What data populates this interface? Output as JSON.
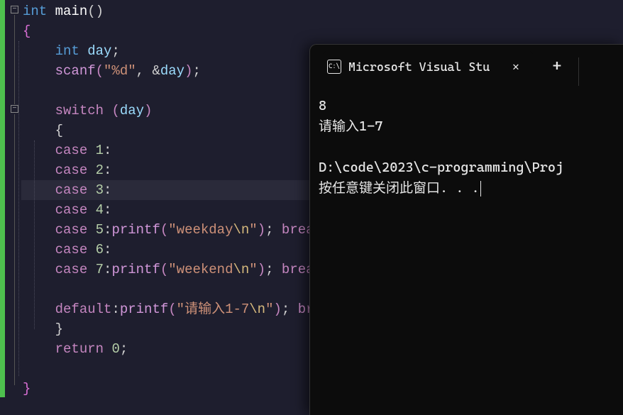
{
  "editor": {
    "fold_symbol": "−",
    "lines": [
      {
        "indent": 0,
        "tokens": [
          [
            "type",
            "int "
          ],
          [
            "white",
            "main"
          ],
          [
            "punc",
            "()"
          ]
        ]
      },
      {
        "indent": 0,
        "tokens": [
          [
            "brace",
            "{"
          ]
        ]
      },
      {
        "indent": 1,
        "tokens": [
          [
            "type",
            "int "
          ],
          [
            "var",
            "day"
          ],
          [
            "punc",
            ";"
          ]
        ]
      },
      {
        "indent": 1,
        "tokens": [
          [
            "iofunc",
            "scanf"
          ],
          [
            "paren",
            "("
          ],
          [
            "str",
            "\"%d\""
          ],
          [
            "punc",
            ", &"
          ],
          [
            "var",
            "day"
          ],
          [
            "paren",
            ")"
          ],
          [
            "punc",
            ";"
          ]
        ]
      },
      {
        "indent": 1,
        "tokens": []
      },
      {
        "indent": 1,
        "tokens": [
          [
            "ctrl",
            "switch "
          ],
          [
            "paren",
            "("
          ],
          [
            "var",
            "day"
          ],
          [
            "paren",
            ")"
          ]
        ]
      },
      {
        "indent": 1,
        "tokens": [
          [
            "punc",
            "{"
          ]
        ]
      },
      {
        "indent": 1,
        "tokens": [
          [
            "case",
            "case "
          ],
          [
            "num",
            "1"
          ],
          [
            "punc",
            ":"
          ]
        ]
      },
      {
        "indent": 1,
        "tokens": [
          [
            "case",
            "case "
          ],
          [
            "num",
            "2"
          ],
          [
            "punc",
            ":"
          ]
        ]
      },
      {
        "indent": 1,
        "hl": true,
        "tokens": [
          [
            "case",
            "case "
          ],
          [
            "num",
            "3"
          ],
          [
            "punc",
            ":"
          ]
        ]
      },
      {
        "indent": 1,
        "tokens": [
          [
            "case",
            "case "
          ],
          [
            "num",
            "4"
          ],
          [
            "punc",
            ":"
          ]
        ]
      },
      {
        "indent": 1,
        "tokens": [
          [
            "case",
            "case "
          ],
          [
            "num",
            "5"
          ],
          [
            "punc",
            ":"
          ],
          [
            "iofunc",
            "printf"
          ],
          [
            "paren",
            "("
          ],
          [
            "str",
            "\"weekday"
          ],
          [
            "esc",
            "\\n"
          ],
          [
            "str",
            "\""
          ],
          [
            "paren",
            ")"
          ],
          [
            "punc",
            "; "
          ],
          [
            "ctrl",
            "break"
          ],
          [
            "punc",
            ";"
          ]
        ]
      },
      {
        "indent": 1,
        "tokens": [
          [
            "case",
            "case "
          ],
          [
            "num",
            "6"
          ],
          [
            "punc",
            ":"
          ]
        ]
      },
      {
        "indent": 1,
        "tokens": [
          [
            "case",
            "case "
          ],
          [
            "num",
            "7"
          ],
          [
            "punc",
            ":"
          ],
          [
            "iofunc",
            "printf"
          ],
          [
            "paren",
            "("
          ],
          [
            "str",
            "\"weekend"
          ],
          [
            "esc",
            "\\n"
          ],
          [
            "str",
            "\""
          ],
          [
            "paren",
            ")"
          ],
          [
            "punc",
            "; "
          ],
          [
            "ctrl",
            "break"
          ],
          [
            "punc",
            ";"
          ]
        ]
      },
      {
        "indent": 1,
        "tokens": []
      },
      {
        "indent": 1,
        "tokens": [
          [
            "case",
            "default"
          ],
          [
            "punc",
            ":"
          ],
          [
            "iofunc",
            "printf"
          ],
          [
            "paren",
            "("
          ],
          [
            "str",
            "\"请输入1-7"
          ],
          [
            "esc",
            "\\n"
          ],
          [
            "str",
            "\""
          ],
          [
            "paren",
            ")"
          ],
          [
            "punc",
            "; "
          ],
          [
            "ctrl",
            "break"
          ],
          [
            "punc",
            ";"
          ]
        ]
      },
      {
        "indent": 1,
        "tokens": [
          [
            "punc",
            "}"
          ]
        ]
      },
      {
        "indent": 1,
        "tokens": [
          [
            "ctrl",
            "return "
          ],
          [
            "num",
            "0"
          ],
          [
            "punc",
            ";"
          ]
        ]
      },
      {
        "indent": 0,
        "tokens": []
      },
      {
        "indent": 0,
        "tokens": [
          [
            "brace",
            "}"
          ]
        ]
      }
    ]
  },
  "terminal": {
    "tab_icon_text": "C:\\",
    "tab_title": "Microsoft Visual Studio 调试控",
    "close_glyph": "✕",
    "plus_glyph": "+",
    "lines": [
      "8",
      "请输入1-7",
      "",
      "D:\\code\\2023\\c-programming\\Proj",
      "按任意键关闭此窗口. . ."
    ]
  }
}
